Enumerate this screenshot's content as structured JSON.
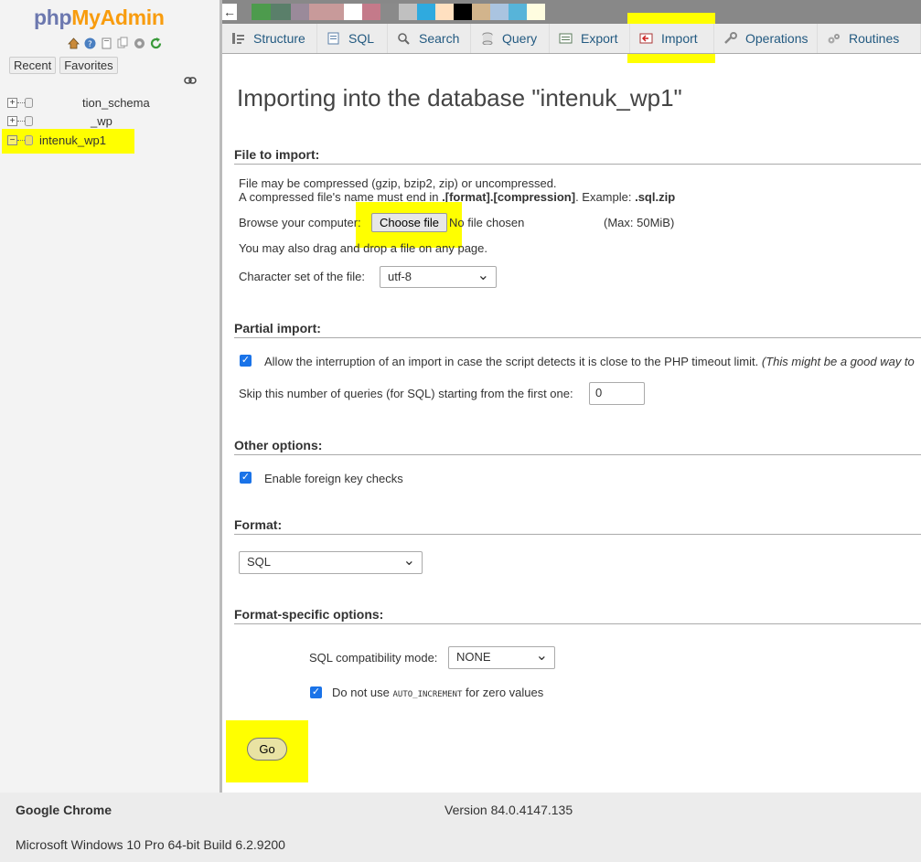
{
  "sidebar": {
    "logo_php": "php",
    "logo_my": "MyAdmin",
    "tabs": [
      "Recent",
      "Favorites"
    ],
    "databases": [
      {
        "name": "tion_schema",
        "expanded": false
      },
      {
        "name": "_wp",
        "expanded": false
      },
      {
        "name": "intenuk_wp1",
        "expanded": true
      }
    ]
  },
  "colorbar": [
    "#4d9b4d",
    "#5a7f6a",
    "#9a8a9a",
    "#c89a9a",
    "#c89a9a",
    "#ffffff",
    "#c47a8a",
    "#8a8a8a",
    "#c0c0c0",
    "#2faadf",
    "#ffe0c0",
    "#000000",
    "#d2b48c",
    "#aac4e0",
    "#57b4d9",
    "#fffde0"
  ],
  "navtabs": [
    {
      "label": "Structure",
      "icon": "structure-icon"
    },
    {
      "label": "SQL",
      "icon": "sql-icon"
    },
    {
      "label": "Search",
      "icon": "search-icon"
    },
    {
      "label": "Query",
      "icon": "query-icon"
    },
    {
      "label": "Export",
      "icon": "export-icon"
    },
    {
      "label": "Import",
      "icon": "import-icon",
      "active": true
    },
    {
      "label": "Operations",
      "icon": "wrench-icon"
    },
    {
      "label": "Routines",
      "icon": "routines-icon"
    }
  ],
  "main": {
    "title": "Importing into the database \"intenuk_wp1\"",
    "file_section": {
      "heading": "File to import:",
      "line1": "File may be compressed (gzip, bzip2, zip) or uncompressed.",
      "line2_prefix": "A compressed file's name must end in ",
      "line2_bold1": ".[format].[compression]",
      "line2_mid": ". Example: ",
      "line2_bold2": ".sql.zip",
      "browse_label": "Browse your computer:",
      "choose_button": "Choose file",
      "no_file": "No file chosen",
      "max_size": "(Max: 50MiB)",
      "drag_text": "You may also drag and drop a file on any page.",
      "charset_label": "Character set of the file:",
      "charset_value": "utf-8"
    },
    "partial_section": {
      "heading": "Partial import:",
      "allow_text": "Allow the interruption of an import in case the script detects it is close to the PHP timeout limit.",
      "allow_note": "(This might be a good way to",
      "allow_checked": true,
      "skip_label": "Skip this number of queries (for SQL) starting from the first one:",
      "skip_value": "0"
    },
    "other_section": {
      "heading": "Other options:",
      "fk_text": "Enable foreign key checks",
      "fk_checked": true
    },
    "format_section": {
      "heading": "Format:",
      "format_value": "SQL"
    },
    "format_specific_section": {
      "heading": "Format-specific options:",
      "compat_label": "SQL compatibility mode:",
      "compat_value": "NONE",
      "auto_inc_prefix": "Do not use ",
      "auto_inc_code": "AUTO_INCREMENT",
      "auto_inc_suffix": " for zero values",
      "auto_inc_checked": true
    },
    "go_button": "Go"
  },
  "footer": {
    "browser": "Google Chrome",
    "version": "Version 84.0.4147.135",
    "os": "Microsoft Windows 10 Pro 64-bit Build 6.2.9200"
  }
}
